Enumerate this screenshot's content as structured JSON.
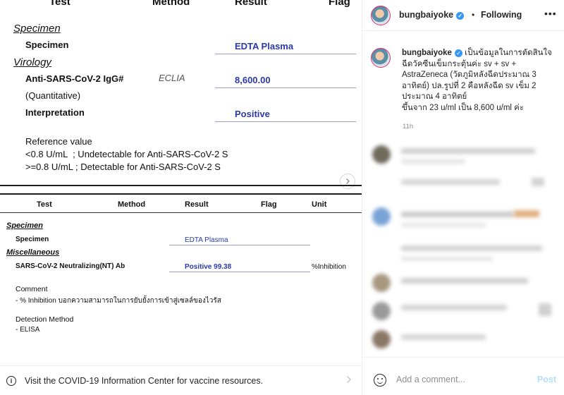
{
  "report1": {
    "headers": {
      "test": "Test",
      "method": "Method",
      "result": "Result",
      "flag": "Flag"
    },
    "section_specimen": "Specimen",
    "specimen_label": "Specimen",
    "specimen_value": "EDTA Plasma",
    "section_virology": "Virology",
    "igg_label": "Anti-SARS-CoV-2 IgG#",
    "igg_sublabel": "(Quantitative)",
    "igg_method": "ECLIA",
    "igg_value": "8,600.00",
    "interp_label": "Interpretation",
    "interp_value": "Positive",
    "ref_title": "Reference value",
    "ref_line1": "<0.8 U/mL  ; Undetectable for Anti-SARS-CoV-2 S",
    "ref_line2": ">=0.8 U/mL ; Detectable for Anti-SARS-CoV-2 S"
  },
  "report2": {
    "headers": {
      "test": "Test",
      "method": "Method",
      "result": "Result",
      "flag": "Flag",
      "unit": "Unit"
    },
    "section_specimen": "Specimen",
    "specimen_label": "Specimen",
    "specimen_value": "EDTA Plasma",
    "section_misc": "Miscellaneous",
    "nt_label": "SARS-CoV-2 Neutralizing(NT) Ab",
    "nt_value": "Positive 99.38",
    "nt_unit": "%Inhibition",
    "comment_title": "Comment",
    "comment_text": "- % Inhibition บอกความสามารถในการยับยั้งการเข้าสู่เซลล์ของไวรัส",
    "detection_title": "Detection Method",
    "detection_text": "- ELISA"
  },
  "covid_banner": {
    "text": "Visit the COVID-19 Information Center for vaccine resources."
  },
  "post": {
    "username": "bungbaiyoke",
    "following_label": "Following",
    "caption_username": "bungbaiyoke",
    "caption_line1": "เป็นข้อมูลในการตัดสินใจ",
    "caption_rest": "ฉีดวัคซีนเข็มกระตุ้นค่ะ sv + sv + AstraZeneca (วัดภูมิหลังฉีดประมาณ 3 อาทิตย์) ปล.รูปที่ 2 คือหลังฉีด sv เข็ม 2 ประมาณ 4 อาทิตย์",
    "caption_line_last": "ขึ้นจาก 23 u/ml เป็น 8,600 u/ml ค่ะ",
    "timestamp": "11h"
  },
  "comment_box": {
    "placeholder": "Add a comment...",
    "post_label": "Post"
  },
  "colors": {
    "verified": "#3897f0",
    "result_blue": "#2b3aa8",
    "post_disabled": "#b2dffc"
  },
  "icons": [
    "info-icon",
    "chevron-right-icon",
    "verified-badge-icon",
    "more-options-icon",
    "emoji-icon"
  ]
}
